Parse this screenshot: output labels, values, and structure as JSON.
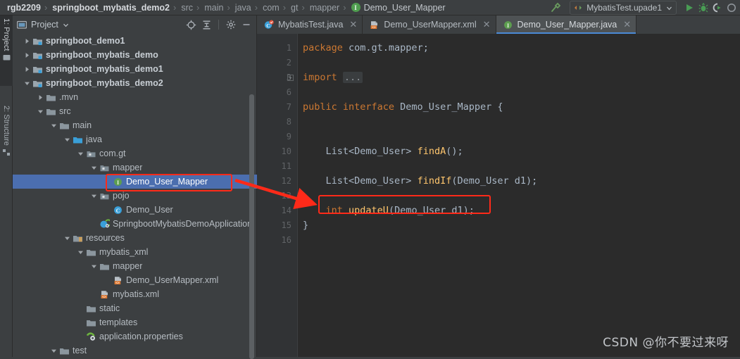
{
  "breadcrumb": {
    "items": [
      {
        "label": "rgb2209",
        "style": "strong"
      },
      {
        "label": "springboot_mybatis_demo2",
        "style": "strong"
      },
      {
        "label": "src",
        "style": "normal"
      },
      {
        "label": "main",
        "style": "normal"
      },
      {
        "label": "java",
        "style": "normal"
      },
      {
        "label": "com",
        "style": "normal"
      },
      {
        "label": "gt",
        "style": "normal"
      },
      {
        "label": "mapper",
        "style": "normal"
      },
      {
        "label": "Demo_User_Mapper",
        "style": "last",
        "icon": "interface-icon",
        "icon_letter": "I"
      }
    ],
    "separator": "›"
  },
  "toolbar": {
    "build_icon": "hammer-icon",
    "run_config": {
      "icon": "run-config-icon",
      "label": "MybatisTest.upade1",
      "dropdown_icon": "chevron-down-icon"
    },
    "run_icon": "run-icon",
    "debug_icon": "debug-icon",
    "coverage_icon": "run-with-coverage-icon",
    "more_icon": "profiler-icon"
  },
  "toolwindow_tabs": [
    {
      "label": "1: Project",
      "icon": "project-icon",
      "active": true
    },
    {
      "label": "2: Structure",
      "icon": "structure-icon",
      "active": false
    }
  ],
  "project_panel": {
    "title": "Project",
    "title_icon": "project-view-icon",
    "dropdown_icon": "chevron-down-icon",
    "tools": [
      {
        "name": "locate-icon",
        "label": "Select Opened File"
      },
      {
        "name": "collapse-all-icon",
        "label": "Collapse All"
      },
      {
        "name": "gear-icon",
        "label": "Settings"
      },
      {
        "name": "minimize-icon",
        "label": "Hide"
      }
    ],
    "tree": [
      {
        "label": "springboot_demo1",
        "indent": 0,
        "twisty": "collapsed",
        "icon": "module-icon",
        "bold": true,
        "selected": false
      },
      {
        "label": "springboot_mybatis_demo",
        "indent": 0,
        "twisty": "collapsed",
        "icon": "module-icon",
        "bold": true,
        "selected": false
      },
      {
        "label": "springboot_mybatis_demo1",
        "indent": 0,
        "twisty": "collapsed",
        "icon": "module-icon",
        "bold": true,
        "selected": false
      },
      {
        "label": "springboot_mybatis_demo2",
        "indent": 0,
        "twisty": "expanded",
        "icon": "module-icon",
        "bold": true,
        "selected": false
      },
      {
        "label": ".mvn",
        "indent": 1,
        "twisty": "collapsed",
        "icon": "folder-icon",
        "bold": false,
        "selected": false
      },
      {
        "label": "src",
        "indent": 1,
        "twisty": "expanded",
        "icon": "folder-icon",
        "bold": false,
        "selected": false
      },
      {
        "label": "main",
        "indent": 2,
        "twisty": "expanded",
        "icon": "folder-icon",
        "bold": false,
        "selected": false
      },
      {
        "label": "java",
        "indent": 3,
        "twisty": "expanded",
        "icon": "source-folder-icon",
        "bold": false,
        "selected": false
      },
      {
        "label": "com.gt",
        "indent": 4,
        "twisty": "expanded",
        "icon": "package-icon",
        "bold": false,
        "selected": false
      },
      {
        "label": "mapper",
        "indent": 5,
        "twisty": "expanded",
        "icon": "package-icon",
        "bold": false,
        "selected": false
      },
      {
        "label": "Demo_User_Mapper",
        "indent": 6,
        "twisty": "none",
        "icon": "interface-icon",
        "bold": false,
        "selected": true
      },
      {
        "label": "pojo",
        "indent": 5,
        "twisty": "expanded",
        "icon": "package-icon",
        "bold": false,
        "selected": false
      },
      {
        "label": "Demo_User",
        "indent": 6,
        "twisty": "none",
        "icon": "class-icon",
        "bold": false,
        "selected": false
      },
      {
        "label": "SpringbootMybatisDemoApplication",
        "indent": 5,
        "twisty": "none",
        "icon": "spring-class-icon",
        "bold": false,
        "selected": false
      },
      {
        "label": "resources",
        "indent": 3,
        "twisty": "expanded",
        "icon": "resource-folder-icon",
        "bold": false,
        "selected": false
      },
      {
        "label": "mybatis_xml",
        "indent": 4,
        "twisty": "expanded",
        "icon": "folder-icon",
        "bold": false,
        "selected": false
      },
      {
        "label": "mapper",
        "indent": 5,
        "twisty": "expanded",
        "icon": "folder-icon",
        "bold": false,
        "selected": false
      },
      {
        "label": "Demo_UserMapper.xml",
        "indent": 6,
        "twisty": "none",
        "icon": "xml-file-icon",
        "bold": false,
        "selected": false
      },
      {
        "label": "mybatis.xml",
        "indent": 5,
        "twisty": "none",
        "icon": "xml-file-icon",
        "bold": false,
        "selected": false
      },
      {
        "label": "static",
        "indent": 4,
        "twisty": "none",
        "icon": "folder-icon",
        "bold": false,
        "selected": false
      },
      {
        "label": "templates",
        "indent": 4,
        "twisty": "none",
        "icon": "folder-icon",
        "bold": false,
        "selected": false
      },
      {
        "label": "application.properties",
        "indent": 4,
        "twisty": "none",
        "icon": "spring-properties-icon",
        "bold": false,
        "selected": false
      },
      {
        "label": "test",
        "indent": 2,
        "twisty": "expanded",
        "icon": "folder-icon",
        "bold": false,
        "selected": false
      }
    ]
  },
  "editor": {
    "tabs": [
      {
        "label": "MybatisTest.java",
        "icon": "test-class-icon",
        "active": false,
        "close_icon": "close-icon"
      },
      {
        "label": "Demo_UserMapper.xml",
        "icon": "mybatis-xml-icon",
        "active": false,
        "close_icon": "close-icon"
      },
      {
        "label": "Demo_User_Mapper.java",
        "icon": "interface-icon",
        "active": true,
        "close_icon": "close-icon"
      }
    ],
    "gutter_lines": [
      "1",
      "2",
      "3",
      "6",
      "7",
      "8",
      "9",
      "10",
      "11",
      "12",
      "13",
      "14",
      "15",
      "16"
    ],
    "fold_marker": "+",
    "code_lines": [
      {
        "line": "1",
        "tokens": [
          {
            "t": "package ",
            "c": "kw"
          },
          {
            "t": "com.gt.mapper;",
            "c": "pl"
          }
        ]
      },
      {
        "line": "2",
        "tokens": []
      },
      {
        "line": "3",
        "tokens": [
          {
            "t": "import ",
            "c": "kw"
          },
          {
            "t": "...",
            "c": "folded"
          }
        ]
      },
      {
        "line": "6",
        "tokens": []
      },
      {
        "line": "7",
        "tokens": [
          {
            "t": "public interface ",
            "c": "kw"
          },
          {
            "t": "Demo_User_Mapper ",
            "c": "pl"
          },
          {
            "t": "{",
            "c": "pl"
          }
        ]
      },
      {
        "line": "8",
        "tokens": []
      },
      {
        "line": "9",
        "tokens": []
      },
      {
        "line": "10",
        "tokens": [
          {
            "t": "    List<Demo_User> ",
            "c": "pl"
          },
          {
            "t": "findA",
            "c": "mth"
          },
          {
            "t": "();",
            "c": "pl"
          }
        ]
      },
      {
        "line": "11",
        "tokens": []
      },
      {
        "line": "12",
        "tokens": [
          {
            "t": "    List<Demo_User> ",
            "c": "pl"
          },
          {
            "t": "findIf",
            "c": "mth"
          },
          {
            "t": "(Demo_User d1);",
            "c": "pl"
          }
        ]
      },
      {
        "line": "13",
        "tokens": []
      },
      {
        "line": "14",
        "tokens": [
          {
            "t": "    int ",
            "c": "kw"
          },
          {
            "t": "updateU",
            "c": "mth"
          },
          {
            "t": "(Demo_User d1);",
            "c": "pl"
          }
        ]
      },
      {
        "line": "15",
        "tokens": [
          {
            "t": "}",
            "c": "pl"
          }
        ]
      },
      {
        "line": "16",
        "tokens": []
      }
    ]
  },
  "annotations": {
    "highlight_tree_label": "Demo_User_Mapper",
    "highlight_code_label": "int updateU(Demo_User d1);",
    "color": "#ff2a19"
  },
  "watermark": {
    "text": "CSDN @你不要过来呀"
  },
  "colors": {
    "background": "#3c3f41",
    "editor_background": "#2b2b2b",
    "gutter": "#313335",
    "selection": "#4b6eaf",
    "accent_red": "#ff2a19",
    "keyword": "#cc7832",
    "method": "#ffc66d",
    "text": "#a9b7c6"
  }
}
